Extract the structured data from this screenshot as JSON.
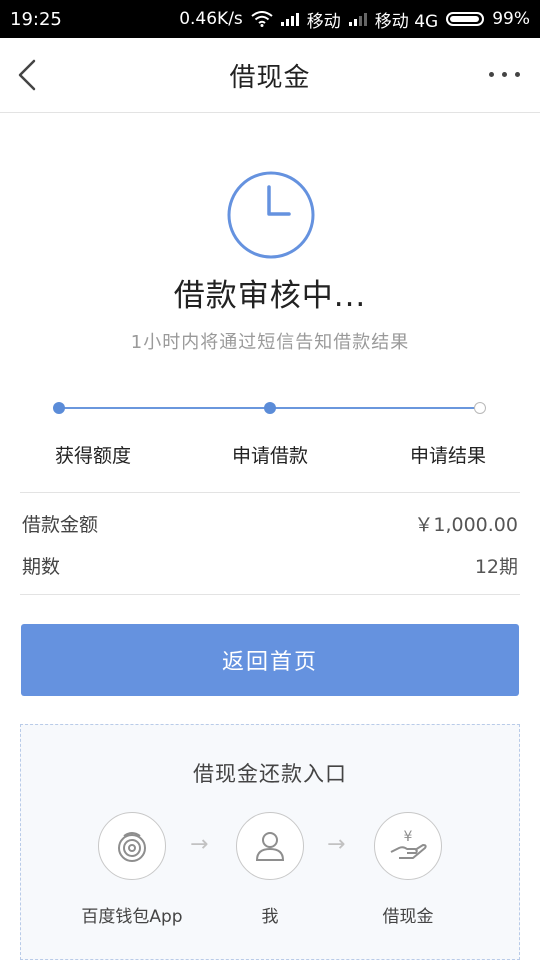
{
  "status_bar": {
    "time": "19:25",
    "speed": "0.46K/s",
    "carrier1": "移动",
    "carrier2": "移动 4G",
    "battery": "99%"
  },
  "nav": {
    "title": "借现金",
    "back_icon": "chevron-left-icon",
    "more_icon": "more-dots-icon"
  },
  "status": {
    "icon": "clock-icon",
    "title": "借款审核中...",
    "subtitle": "1小时内将通过短信告知借款结果"
  },
  "steps": [
    {
      "label": "获得额度",
      "done": true
    },
    {
      "label": "申请借款",
      "done": true
    },
    {
      "label": "申请结果",
      "done": false
    }
  ],
  "loan_info": {
    "amount_label": "借款金额",
    "amount_value": "￥1,000.00",
    "periods_label": "期数",
    "periods_value": "12期"
  },
  "home_button": "返回首页",
  "repay": {
    "title": "借现金还款入口",
    "items": [
      {
        "label": "百度钱包App",
        "icon": "baidu-wallet-icon"
      },
      {
        "label": "我",
        "icon": "user-icon"
      },
      {
        "label": "借现金",
        "icon": "hand-yuan-icon"
      }
    ]
  },
  "colors": {
    "accent": "#6592df",
    "progress": "#5b8cd8",
    "dashed_border": "#b9cbe8"
  }
}
